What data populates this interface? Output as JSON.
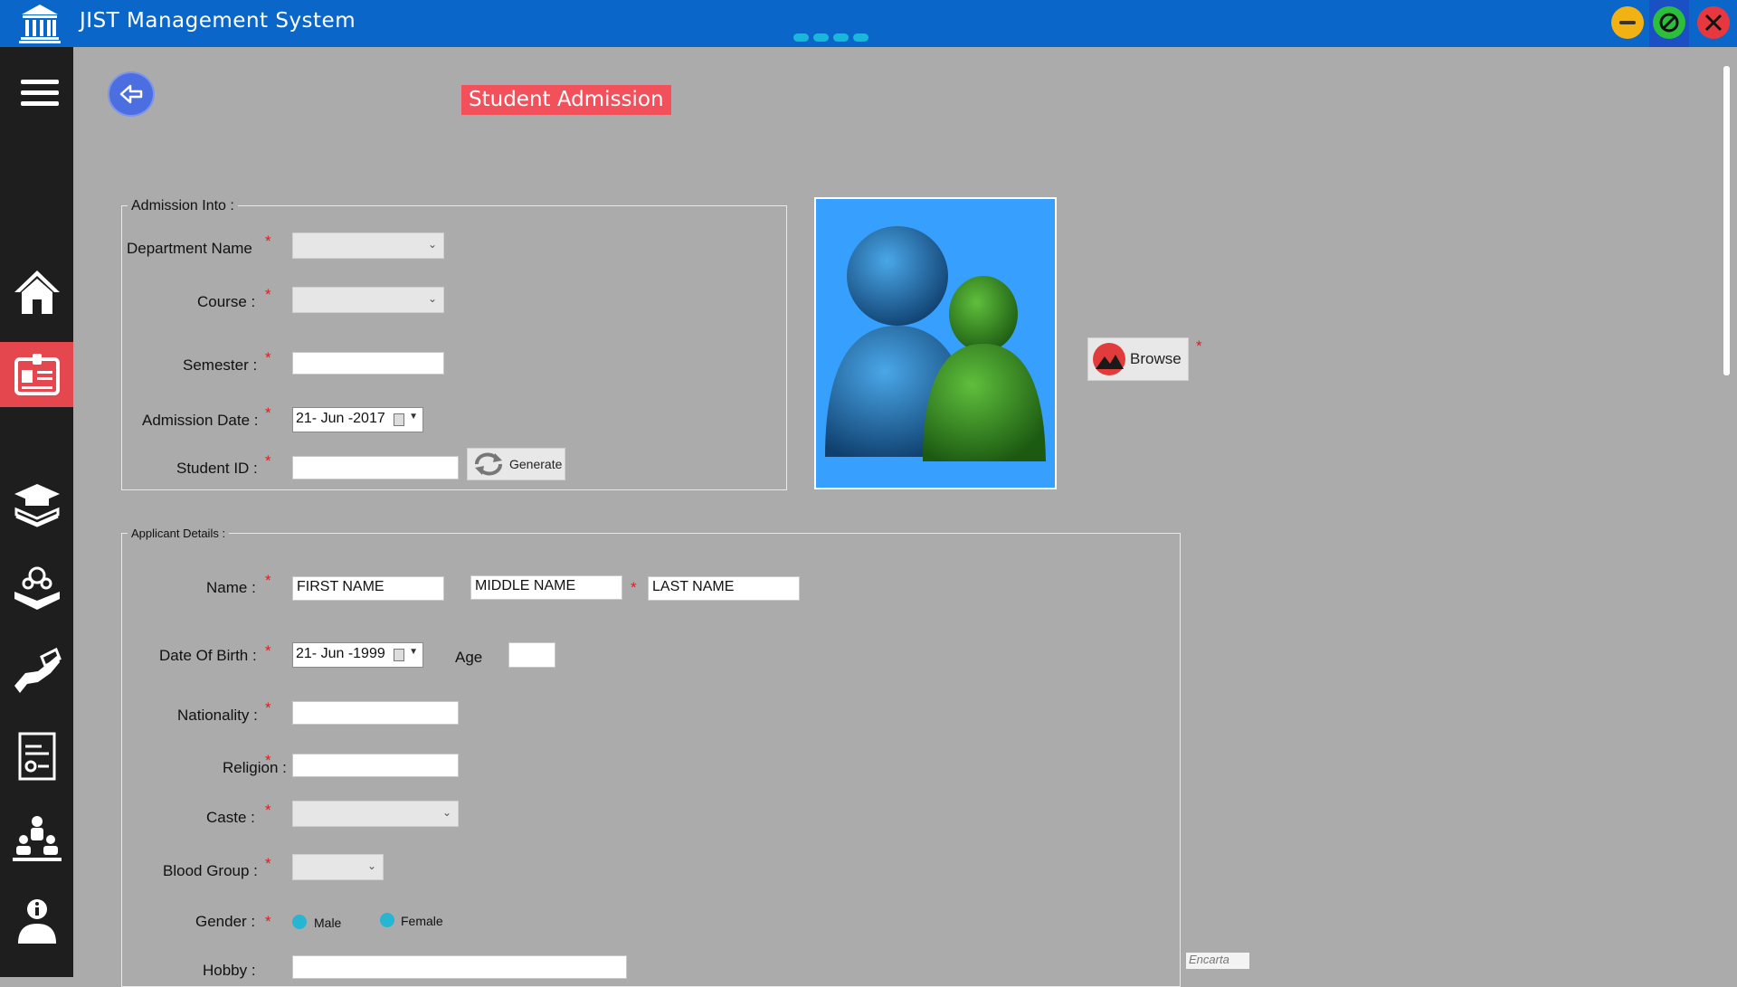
{
  "window": {
    "title": "JIST Management System",
    "controls": {
      "minimize_color": "#f2b213",
      "maximize_color": "#2cbf3b",
      "close_color": "#e8383f"
    }
  },
  "sidebar": {
    "items": [
      {
        "name": "home",
        "icon": "home-icon",
        "active": false
      },
      {
        "name": "student-admission",
        "icon": "id-card-icon",
        "active": true
      },
      {
        "name": "courses",
        "icon": "graduation-cap-book-icon",
        "active": false
      },
      {
        "name": "library",
        "icon": "reading-book-icon",
        "active": false
      },
      {
        "name": "fees",
        "icon": "hand-money-icon",
        "active": false
      },
      {
        "name": "certificates",
        "icon": "certificate-icon",
        "active": false
      },
      {
        "name": "classroom",
        "icon": "teacher-students-icon",
        "active": false
      },
      {
        "name": "about",
        "icon": "info-person-icon",
        "active": false
      }
    ]
  },
  "page": {
    "title": "Student Admission"
  },
  "admission": {
    "legend": "Admission Into :",
    "department_label": "Department Name",
    "course_label": "Course :",
    "semester_label": "Semester :",
    "admission_date_label": "Admission Date :",
    "admission_date_value": "21- Jun -2017",
    "student_id_label": "Student ID :",
    "generate_label": "Generate"
  },
  "photo": {
    "browse_label": "Browse"
  },
  "applicant": {
    "legend": "Applicant Details :",
    "name_label": "Name :",
    "first_name": "FIRST NAME",
    "middle_name": "MIDDLE NAME",
    "last_name": "LAST NAME",
    "dob_label": "Date Of Birth :",
    "dob_value": "21- Jun -1999",
    "age_label": "Age",
    "nationality_label": "Nationality :",
    "religion_label": "Religion :",
    "caste_label": "Caste :",
    "blood_group_label": "Blood Group :",
    "gender_label": "Gender :",
    "gender_options": [
      "Male",
      "Female"
    ],
    "hobby_label": "Hobby :"
  },
  "required_mark": "*",
  "watermark": "Encarta"
}
